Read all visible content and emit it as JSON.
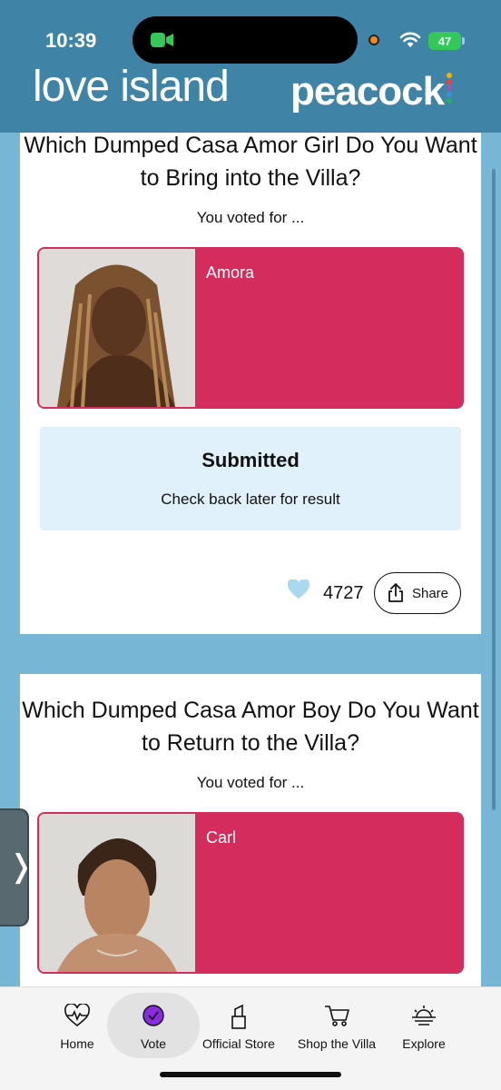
{
  "status_bar": {
    "time": "10:39",
    "battery": "47"
  },
  "header": {
    "logo_left": "love island",
    "logo_right": "peacock"
  },
  "polls": [
    {
      "question": "Which Dumped Casa Amor Girl Do You Want to Bring into the Villa?",
      "voted_label": "You voted for ...",
      "choice_name": "Amora",
      "status_title": "Submitted",
      "status_text": "Check back later for result",
      "likes": "4727",
      "share_label": "Share"
    },
    {
      "question": "Which Dumped Casa Amor Boy Do You Want to Return to the Villa?",
      "voted_label": "You voted for ...",
      "choice_name": "Carl"
    }
  ],
  "bottom_nav": [
    {
      "label": "Home",
      "icon": "heartbeat-icon"
    },
    {
      "label": "Vote",
      "icon": "check-circle-icon",
      "active": true
    },
    {
      "label": "Official Store",
      "icon": "lipstick-icon"
    },
    {
      "label": "Shop the Villa",
      "icon": "cart-icon"
    },
    {
      "label": "Explore",
      "icon": "sunset-icon"
    }
  ],
  "colors": {
    "header": "#3f83a6",
    "background": "#78b6d6",
    "choice": "#d42c5c",
    "submitted_bg": "#e1f1fb",
    "vote_icon": "#8a2be2"
  }
}
